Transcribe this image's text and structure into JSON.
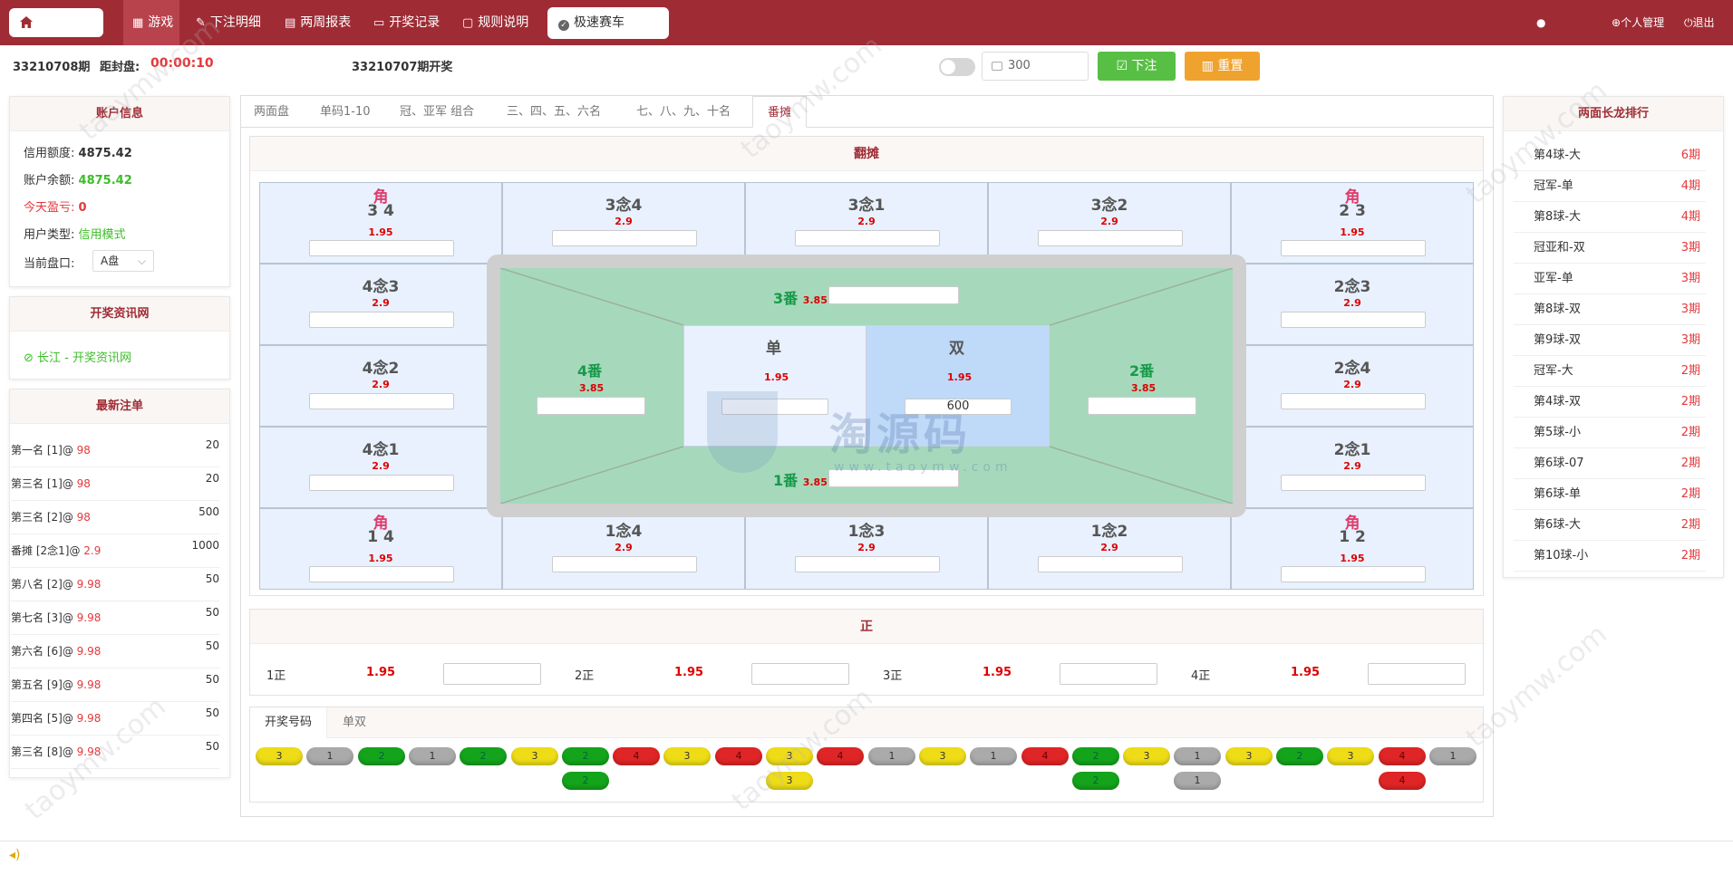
{
  "nav": {
    "items": [
      {
        "label": "游戏",
        "icon": "grid-icon"
      },
      {
        "label": "下注明细",
        "icon": "pen-icon"
      },
      {
        "label": "两周报表",
        "icon": "calendar-icon"
      },
      {
        "label": "开奖记录",
        "icon": "monitor-icon"
      },
      {
        "label": "规则说明",
        "icon": "message-icon"
      }
    ],
    "game_button": "极速赛车",
    "personal": "个人管理",
    "logout": "退出"
  },
  "header": {
    "period": "33210708期",
    "close_label": "距封盘:",
    "countdown": "00:00:10",
    "last_draw": "33210707期开奖",
    "amount": "300",
    "bet_button": "下注",
    "reset_button": "重置"
  },
  "account": {
    "title": "账户信息",
    "credit_label": "信用额度:",
    "credit": "4875.42",
    "balance_label": "账户余额:",
    "balance": "4875.42",
    "pnl_label": "今天盈亏:",
    "pnl": "0",
    "type_label": "用户类型:",
    "type": "信用模式",
    "plate_label": "当前盘口:",
    "plate": "A盘"
  },
  "news": {
    "title": "开奖资讯网",
    "link": "长江 - 开奖资讯网"
  },
  "recent": {
    "title": "最新注单",
    "rows": [
      {
        "label": "第一名 [1]@ ",
        "odds": "98",
        "amount": "20"
      },
      {
        "label": "第三名 [1]@ ",
        "odds": "98",
        "amount": "20"
      },
      {
        "label": "第三名 [2]@ ",
        "odds": "98",
        "amount": "500"
      },
      {
        "label": "番摊 [2念1]@ ",
        "odds": "2.9",
        "amount": "1000"
      },
      {
        "label": "第八名 [2]@ ",
        "odds": "9.98",
        "amount": "50"
      },
      {
        "label": "第七名 [3]@ ",
        "odds": "9.98",
        "amount": "50"
      },
      {
        "label": "第六名 [6]@ ",
        "odds": "9.98",
        "amount": "50"
      },
      {
        "label": "第五名 [9]@ ",
        "odds": "9.98",
        "amount": "50"
      },
      {
        "label": "第四名 [5]@ ",
        "odds": "9.98",
        "amount": "50"
      },
      {
        "label": "第三名 [8]@ ",
        "odds": "9.98",
        "amount": "50"
      }
    ]
  },
  "tabs": [
    "两面盘",
    "单码1-10",
    "冠、亚军 组合",
    "三、四、五、六名",
    "七、八、九、十名",
    "番摊"
  ],
  "fantan": {
    "title": "翻摊",
    "jiao": "角",
    "top": [
      {
        "name": "3 4",
        "odds": "1.95"
      },
      {
        "name": "3念4",
        "odds": "2.9"
      },
      {
        "name": "3念1",
        "odds": "2.9"
      },
      {
        "name": "3念2",
        "odds": "2.9"
      },
      {
        "name": "2 3",
        "odds": "1.95"
      }
    ],
    "left": [
      {
        "name": "4念3",
        "odds": "2.9"
      },
      {
        "name": "4念2",
        "odds": "2.9"
      },
      {
        "name": "4念1",
        "odds": "2.9"
      }
    ],
    "right": [
      {
        "name": "2念3",
        "odds": "2.9"
      },
      {
        "name": "2念4",
        "odds": "2.9"
      },
      {
        "name": "2念1",
        "odds": "2.9"
      }
    ],
    "bottom": [
      {
        "name": "1 4",
        "odds": "1.95"
      },
      {
        "name": "1念4",
        "odds": "2.9"
      },
      {
        "name": "1念3",
        "odds": "2.9"
      },
      {
        "name": "1念2",
        "odds": "2.9"
      },
      {
        "name": "1 2",
        "odds": "1.95"
      }
    ],
    "fan3": {
      "label": "3番",
      "odds": "3.85"
    },
    "fan4": {
      "label": "4番",
      "odds": "3.85"
    },
    "fan2": {
      "label": "2番",
      "odds": "3.85"
    },
    "fan1": {
      "label": "1番",
      "odds": "3.85"
    },
    "dan": {
      "label": "单",
      "odds": "1.95"
    },
    "shuang": {
      "label": "双",
      "odds": "1.95",
      "value": "600"
    }
  },
  "zheng": {
    "title": "正",
    "items": [
      {
        "label": "1正",
        "odds": "1.95"
      },
      {
        "label": "2正",
        "odds": "1.95"
      },
      {
        "label": "3正",
        "odds": "1.95"
      },
      {
        "label": "4正",
        "odds": "1.95"
      }
    ]
  },
  "results": {
    "tabs": [
      "开奖号码",
      "单双"
    ],
    "row1": [
      {
        "v": "3",
        "c": "y"
      },
      {
        "v": "1",
        "c": "s"
      },
      {
        "v": "2",
        "c": "g"
      },
      {
        "v": "1",
        "c": "s"
      },
      {
        "v": "2",
        "c": "g"
      },
      {
        "v": "3",
        "c": "y"
      },
      {
        "v": "2",
        "c": "g"
      },
      {
        "v": "4",
        "c": "r"
      },
      {
        "v": "3",
        "c": "y"
      },
      {
        "v": "4",
        "c": "r"
      },
      {
        "v": "3",
        "c": "y"
      },
      {
        "v": "4",
        "c": "r"
      },
      {
        "v": "1",
        "c": "s"
      },
      {
        "v": "3",
        "c": "y"
      },
      {
        "v": "1",
        "c": "s"
      },
      {
        "v": "4",
        "c": "r"
      },
      {
        "v": "2",
        "c": "g"
      },
      {
        "v": "3",
        "c": "y"
      },
      {
        "v": "1",
        "c": "s"
      },
      {
        "v": "3",
        "c": "y"
      },
      {
        "v": "2",
        "c": "g"
      },
      {
        "v": "3",
        "c": "y"
      },
      {
        "v": "4",
        "c": "r"
      },
      {
        "v": "1",
        "c": "s"
      }
    ],
    "row2": [
      {
        "i": 6,
        "v": "2",
        "c": "g"
      },
      {
        "i": 10,
        "v": "3",
        "c": "y"
      },
      {
        "i": 16,
        "v": "2",
        "c": "g"
      },
      {
        "i": 18,
        "v": "1",
        "c": "s"
      },
      {
        "i": 22,
        "v": "4",
        "c": "r"
      }
    ]
  },
  "ranking": {
    "title": "两面长龙排行",
    "rows": [
      {
        "name": "第4球-大",
        "periods": "6期"
      },
      {
        "name": "冠军-单",
        "periods": "4期"
      },
      {
        "name": "第8球-大",
        "periods": "4期"
      },
      {
        "name": "冠亚和-双",
        "periods": "3期"
      },
      {
        "name": "亚军-单",
        "periods": "3期"
      },
      {
        "name": "第8球-双",
        "periods": "3期"
      },
      {
        "name": "第9球-双",
        "periods": "3期"
      },
      {
        "name": "冠军-大",
        "periods": "2期"
      },
      {
        "name": "第4球-双",
        "periods": "2期"
      },
      {
        "name": "第5球-小",
        "periods": "2期"
      },
      {
        "name": "第6球-07",
        "periods": "2期"
      },
      {
        "name": "第6球-单",
        "periods": "2期"
      },
      {
        "name": "第6球-大",
        "periods": "2期"
      },
      {
        "name": "第10球-小",
        "periods": "2期"
      }
    ]
  },
  "watermark": {
    "text": "taoymw.com",
    "logo": "淘源码",
    "logo_sub": "www.taoymw.com"
  }
}
